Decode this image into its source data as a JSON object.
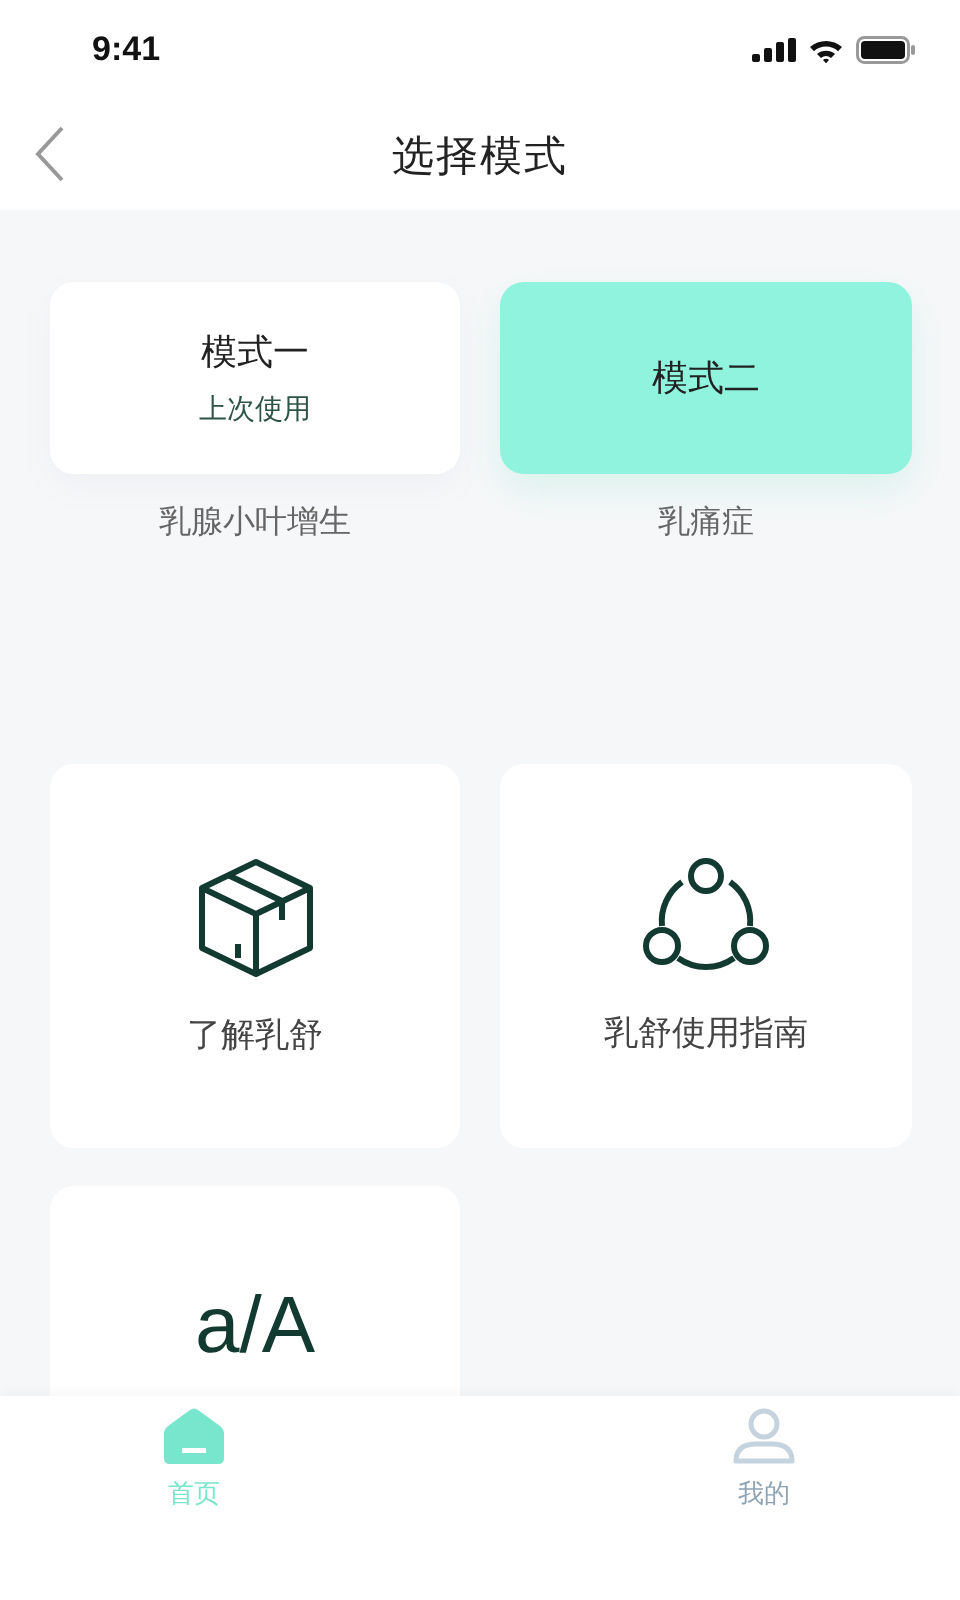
{
  "status_bar": {
    "time": "9:41"
  },
  "header": {
    "title": "选择模式"
  },
  "modes": [
    {
      "title": "模式一",
      "note": "上次使用",
      "description": "乳腺小叶增生",
      "selected": false
    },
    {
      "title": "模式二",
      "description": "乳痛症",
      "selected": true
    }
  ],
  "features": [
    {
      "kind": "box",
      "label": "了解乳舒"
    },
    {
      "kind": "nodes",
      "label": "乳舒使用指南"
    },
    {
      "kind": "text-size",
      "glyph": "a/A"
    }
  ],
  "tabs": [
    {
      "kind": "home",
      "label": "首页",
      "selected": true
    },
    {
      "kind": "profile",
      "label": "我的",
      "selected": false
    }
  ]
}
